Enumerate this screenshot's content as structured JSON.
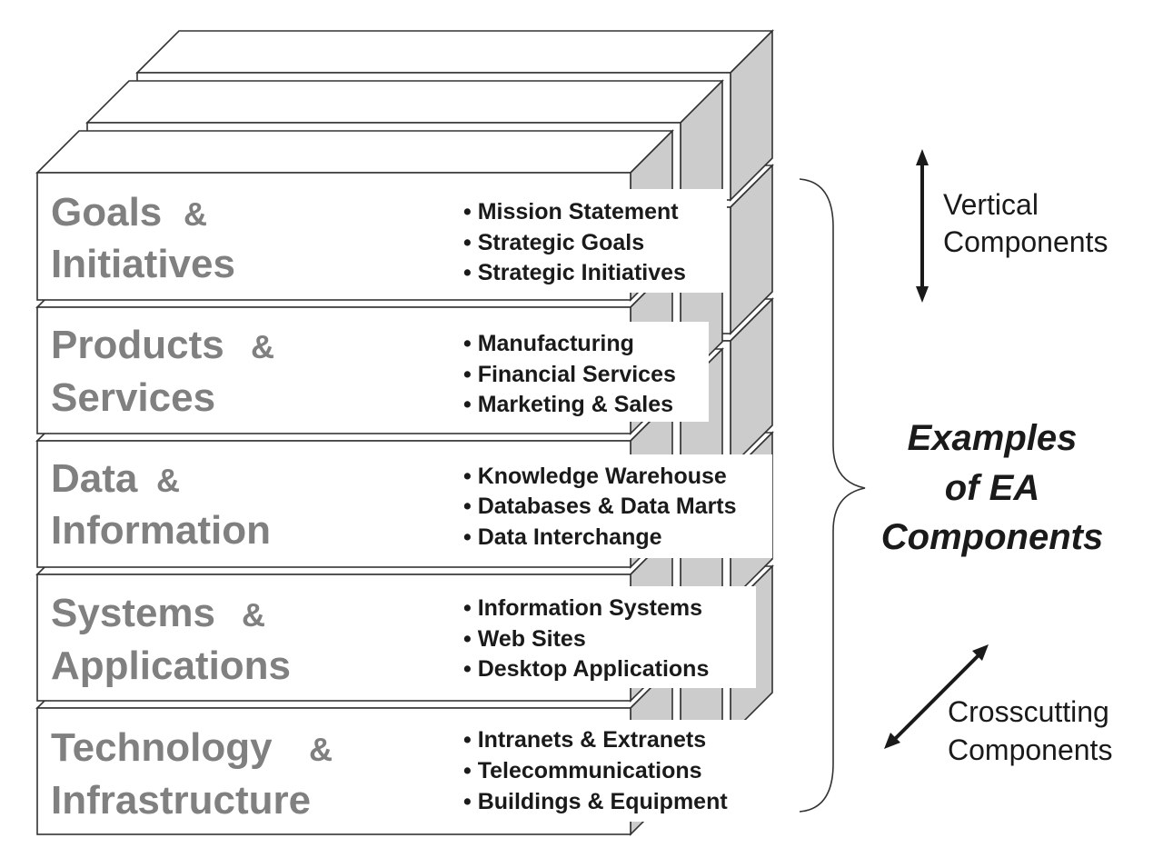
{
  "layers": [
    {
      "title_line1": "Goals",
      "title_amp": "&",
      "title_line2": "Initiatives",
      "bullets": [
        "• Mission Statement",
        "• Strategic Goals",
        "• Strategic Initiatives"
      ]
    },
    {
      "title_line1": "Products",
      "title_amp": "&",
      "title_line2": "Services",
      "bullets": [
        "• Manufacturing",
        "• Financial Services",
        "• Marketing & Sales"
      ]
    },
    {
      "title_line1": "Data",
      "title_amp": "&",
      "title_line2": "Information",
      "bullets": [
        "• Knowledge Warehouse",
        "• Databases & Data Marts",
        "• Data Interchange"
      ]
    },
    {
      "title_line1": "Systems",
      "title_amp": "&",
      "title_line2": "Applications",
      "bullets": [
        "• Information Systems",
        "• Web Sites",
        "• Desktop Applications"
      ]
    },
    {
      "title_line1": "Technology",
      "title_amp": "&",
      "title_line2": "Infrastructure",
      "bullets": [
        "• Intranets & Extranets",
        "• Telecommunications",
        "• Buildings & Equipment"
      ]
    }
  ],
  "annotations": {
    "vertical_line1": "Vertical",
    "vertical_line2": "Components",
    "crosscutting_line1": "Crosscutting",
    "crosscutting_line2": "Components",
    "center_line1": "Examples",
    "center_line2": "of EA",
    "center_line3": "Components"
  },
  "colors": {
    "stroke": "#333333",
    "face": "#ffffff",
    "side": "#cccccc",
    "title": "#808080",
    "text": "#1a1a1a"
  }
}
